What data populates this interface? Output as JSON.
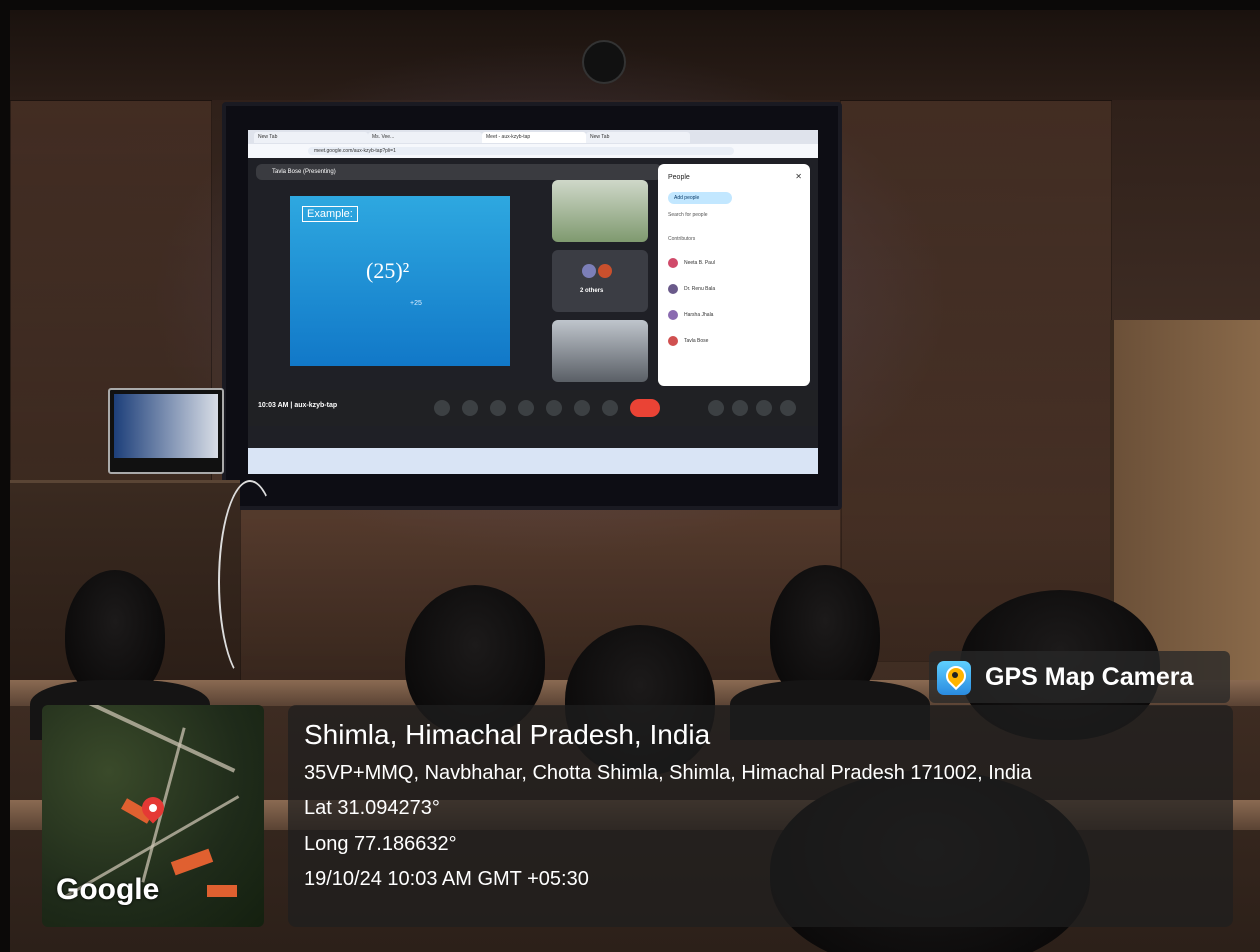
{
  "overlay": {
    "brand_label": "GPS Map Camera",
    "brand_icon": "gps-pin-icon",
    "location_title": "Shimla, Himachal Pradesh, India",
    "address": "35VP+MMQ, Navbhahar, Chotta Shimla, Shimla, Himachal Pradesh 171002, India",
    "latitude": "Lat 31.094273°",
    "longitude": "Long 77.186632°",
    "datetime": "19/10/24 10:03 AM GMT +05:30",
    "map_logo": "Google"
  },
  "screen": {
    "tabs": [
      "New Tab",
      "Ms. Vee...",
      "Meet - aux-kzyb-tap",
      "New Tab"
    ],
    "url": "meet.google.com/aux-kzyb-tap?pli=1",
    "presenter": "Tavla Bose (Presenting)",
    "slide_heading": "Example:",
    "slide_equation": "(25)²",
    "slide_note": "+25",
    "tile_others": "2 others",
    "people_header": "People",
    "add_people": "Add people",
    "search_people": "Search for people",
    "contributors_label": "Contributors",
    "participants": [
      "Neeta B. Paul",
      "Dr. Renu Bala",
      "Harsha Jhala",
      "Tavla Bose"
    ],
    "meeting_time": "10:03 AM | aux-kzyb-tap"
  },
  "colors": {
    "slide_blue": "#1f8fd6",
    "end_call_red": "#ea4335",
    "overlay_bg": "#1e1e1e"
  }
}
